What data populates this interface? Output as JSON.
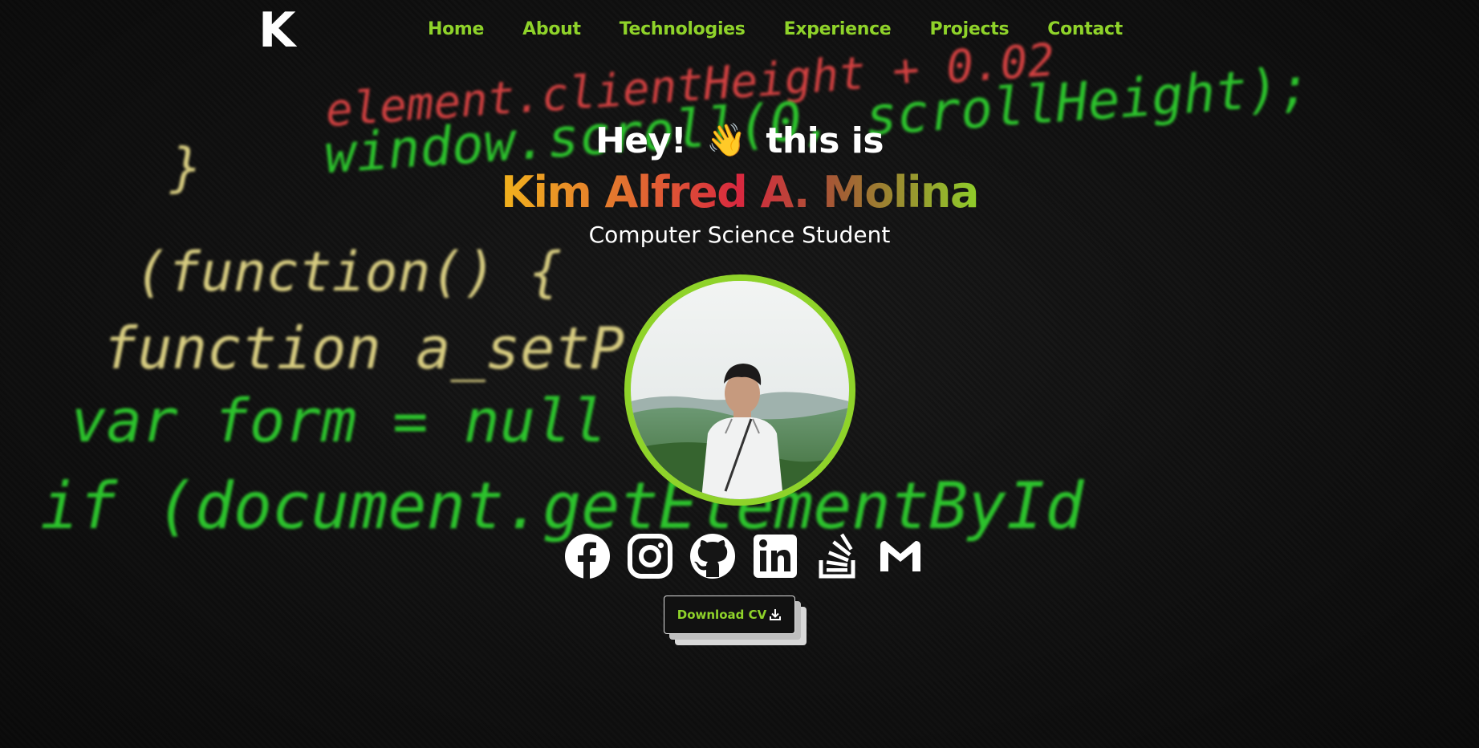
{
  "nav": {
    "logo": "K",
    "links": [
      "Home",
      "About",
      "Technologies",
      "Experience",
      "Projects",
      "Contact"
    ]
  },
  "hero": {
    "greeting_pre": "Hey!",
    "greeting_emoji": "👋",
    "greeting_post": "this is",
    "name": "Kim Alfred A. Molina",
    "subtitle": "Computer Science Student",
    "avatar_alt": "profile photo"
  },
  "socials": [
    {
      "name": "facebook-icon"
    },
    {
      "name": "instagram-icon"
    },
    {
      "name": "github-icon"
    },
    {
      "name": "linkedin-icon"
    },
    {
      "name": "stackoverflow-icon"
    },
    {
      "name": "gmail-icon"
    }
  ],
  "cv": {
    "label": "Download CV",
    "icon": "download-icon"
  },
  "background_code": [
    "element.clientHeight + 0.02",
    "window.scroll(0, scrollHeight);",
    "}",
    "(function() {",
    "function a_setP() {",
    "var form = null",
    "if (document.getElementById"
  ],
  "colors": {
    "accent": "#8fd32a",
    "background": "#151515",
    "name_gradient": [
      "#f1b21d",
      "#e3742f",
      "#d8283f",
      "#a45a35",
      "#8fcd2a"
    ]
  }
}
